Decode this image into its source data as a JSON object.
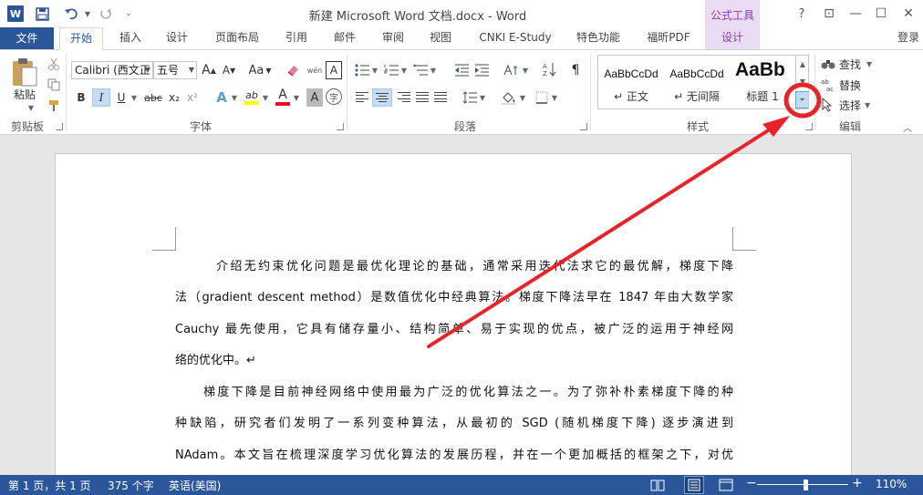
{
  "window": {
    "title": "新建 Microsoft Word 文档.docx - Word",
    "context_tab_group": "公式工具",
    "help": "?",
    "restore_ribbon": "⊡",
    "minimize": "—",
    "maximize": "☐",
    "close": "✕",
    "logo_letter": "W"
  },
  "tabs": [
    {
      "label": "文件"
    },
    {
      "label": "开始"
    },
    {
      "label": "插入"
    },
    {
      "label": "设计"
    },
    {
      "label": "页面布局"
    },
    {
      "label": "引用"
    },
    {
      "label": "邮件"
    },
    {
      "label": "审阅"
    },
    {
      "label": "视图"
    },
    {
      "label": "CNKI E-Study"
    },
    {
      "label": "特色功能"
    },
    {
      "label": "福昕PDF"
    },
    {
      "label": "设计"
    }
  ],
  "signin": "登录",
  "ribbon": {
    "clipboard": {
      "label": "剪贴板",
      "paste": "粘贴"
    },
    "font": {
      "label": "字体",
      "font_name": "Calibri (西文正",
      "font_size": "五号",
      "bold": "B",
      "italic": "I",
      "underline": "U",
      "strike": "abc",
      "sub": "x₂",
      "sup": "x²",
      "grow": "A",
      "shrink": "A",
      "case": "Aa",
      "font_color_letter": "A",
      "highlight_letter": "ab",
      "char_border": "A",
      "phonetic": "wén",
      "text_effect": "A",
      "char_shade": "A",
      "enclose": "字"
    },
    "paragraph": {
      "label": "段落"
    },
    "styles": {
      "label": "样式",
      "items": [
        {
          "preview": "AaBbCcDd",
          "name": "↵ 正文"
        },
        {
          "preview": "AaBbCcDd",
          "name": "↵ 无间隔"
        },
        {
          "preview": "AaBb",
          "name": "标题 1"
        }
      ]
    },
    "editing": {
      "label": "编辑",
      "find": "查找",
      "replace": "替换",
      "select": "选择"
    }
  },
  "document": {
    "paragraphs": [
      {
        "lines": [
          "介绍无约束优化问题是最优化理论的基础，通常采用迭代法求它的最优解，梯度下降",
          "法（gradient descent method）是数值优化中经典算法。梯度下降法早在 1847 年由大数学家",
          "Cauchy 最先使用，它具有储存量小、结构简单、易于实现的优点，被广泛的运用于神经网",
          "络的优化中。↵"
        ]
      },
      {
        "lines": [
          "梯度下降是目前神经网络中使用最为广泛的优化算法之一。为了弥补朴素梯度下降的种",
          "种缺陷，研究者们发明了一系列变种算法，从最初的 SGD (随机梯度下降) 逐步演进到",
          "NAdam。本文旨在梳理深度学习优化算法的发展历程，并在一个更加概括的框架之下，对优"
        ]
      }
    ]
  },
  "status": {
    "page": "第 1 页，共 1 页",
    "words": "375 个字",
    "language": "英语(美国)",
    "zoom": "110%",
    "zoom_minus": "−",
    "zoom_plus": "+"
  },
  "colors": {
    "accent": "#2b579a",
    "context": "#8a3bb4",
    "annotation": "#e8242b",
    "highlight": "#ffff00",
    "font_red": "#e81123"
  }
}
